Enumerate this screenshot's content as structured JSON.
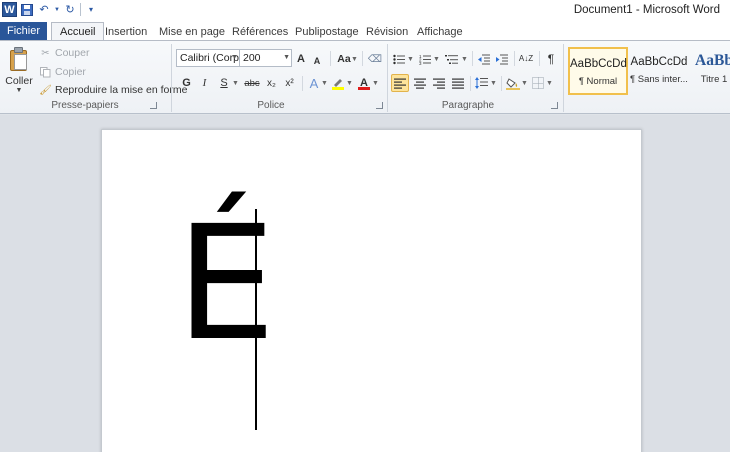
{
  "window": {
    "title": "Document1 - Microsoft Word"
  },
  "qat": {
    "logo_letter": "W"
  },
  "tabs": {
    "file": "Fichier",
    "items": [
      "Accueil",
      "Insertion",
      "Mise en page",
      "Références",
      "Publipostage",
      "Révision",
      "Affichage"
    ],
    "active": "Accueil"
  },
  "clipboard": {
    "paste_label": "Coller",
    "cut_label": "Couper",
    "copy_label": "Copier",
    "format_painter_label": "Reproduire la mise en forme",
    "group_label": "Presse-papiers"
  },
  "font": {
    "name": "Calibri (Corp",
    "size": "200",
    "bold": "G",
    "italic": "I",
    "underline": "S",
    "strike": "abc",
    "subscript": "x₂",
    "superscript": "x²",
    "grow": "A",
    "shrink": "A",
    "case": "Aa",
    "group_label": "Police"
  },
  "paragraph": {
    "group_label": "Paragraphe",
    "pilcrow": "¶",
    "sort": "A↓Z"
  },
  "styles": [
    {
      "sample": "AaBbCcDd",
      "name": "¶ Normal"
    },
    {
      "sample": "AaBbCcDd",
      "name": "¶ Sans inter..."
    },
    {
      "sample": "AaBb",
      "name": "Titre 1"
    }
  ],
  "document": {
    "text": "É"
  },
  "colors": {
    "file_tab": "#2a5699",
    "accent": "#2b5797",
    "highlight": "#fde49b"
  }
}
